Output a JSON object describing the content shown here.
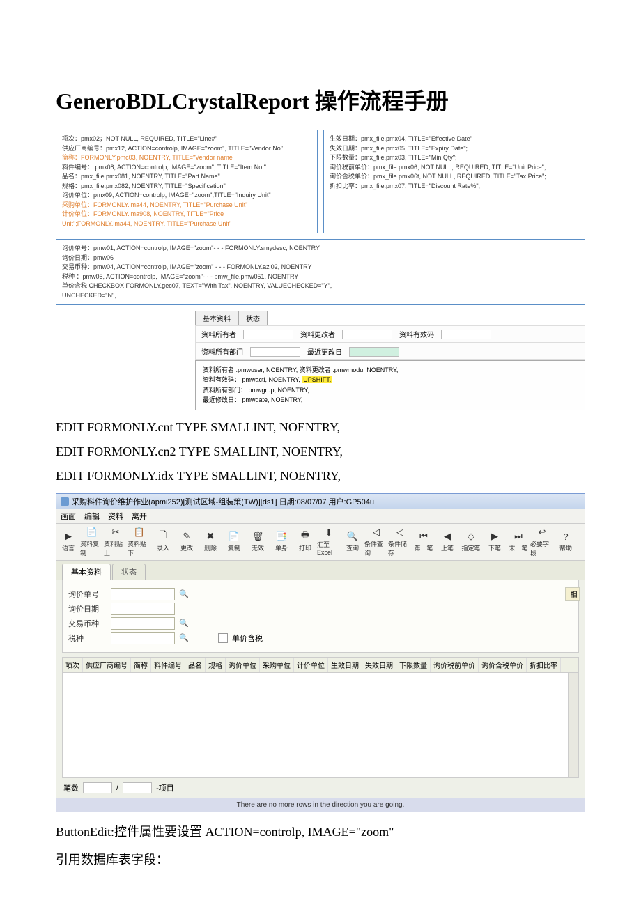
{
  "title": "GeneroBDLCrystalReport 操作流程手册",
  "box_left": [
    "项次：pmx02；NOT NULL, REQUIRED,  TITLE=\"Line#\"",
    "供应厂商编号：pmx12, ACTION=controlp, IMAGE=\"zoom\", TITLE=\"Vendor No\"",
    "简称：FORMONLY.pmc03, NOENTRY, TITLE=\"Vendor name",
    "料件编号： pmx08, ACTION=controlp, IMAGE=\"zoom\", TITLE=\"Item No.\"",
    "品名：pmx_file.pmx081, NOENTRY, TITLE=\"Part Name\"",
    "规格：pmx_file.pmx082, NOENTRY, TITLE=\"Specification\"",
    "询价单位：pmx09, ACTION=controlp, IMAGE=\"zoom\",TITLE=\"Inquiry Unit\"",
    "采购单位：FORMONLY.ima44, NOENTRY, TITLE=\"Purchase Unit\"",
    "计价单位：FORMONLY.ima908, NOENTRY,  TITLE=\"Price",
    "Unit\";FORMONLY.ima44, NOENTRY, TITLE=\"Purchase Unit\""
  ],
  "box_right": [
    "生效日期：pmx_file.pmx04, TITLE=\"Effective Date\"",
    "失效日期：pmx_file.pmx05,  TITLE=\"Expiry Date\";",
    "下限数量：pmx_file.pmx03, TITLE=\"Min.Qty\";",
    "询价税前单价：pmx_file.pmx06, NOT NULL, REQUIRED,  TITLE=\"Unit Price\";",
    "询价含税单价：pmx_file.pmx06t, NOT NULL, REQUIRED, TITLE=\"Tax Price\";",
    "折扣比率：pmx_file.pmx07, TITLE=\"Discount Rate%\";"
  ],
  "box_full": [
    "询价单号：pmw01, ACTION=controlp, IMAGE=\"zoom\"- - - FORMONLY.smydesc, NOENTRY",
    "询价日期：pmw06",
    "交易币种：pmw04, ACTION=controlp, IMAGE=\"zoom\"  - - - FORMONLY.azi02, NOENTRY",
    "税种  ：pmw05, ACTION=controlp, IMAGE=\"zoom\"- - - pmw_file.pmw051, NOENTRY",
    "单价含税   CHECKBOX   FORMONLY.gec07, TEXT=\"With Tax\", NOENTRY, VALUECHECKED=\"Y\",",
    "UNCHECKED=\"N\","
  ],
  "mid_tabs": {
    "t1": "基本资料",
    "t2": "状态"
  },
  "mid_fields": {
    "f1": "资料所有者",
    "f2": "资料更改者",
    "f3": "资料有效码",
    "f4": "资料所有部门",
    "f5": "最近更改日"
  },
  "mid_notes": [
    "资料所有者 :pmwuser, NOENTRY,  资料更改者 :pmwmodu, NOENTRY,",
    "资料有效码： pmwacti, NOENTRY, UPSHIFT,",
    "资料所有部门： pmwgrup, NOENTRY,",
    "最近修改日： pmwdate, NOENTRY,"
  ],
  "edits": [
    "EDIT  FORMONLY.cnt TYPE SMALLINT, NOENTRY,",
    "EDIT FORMONLY.cn2 TYPE SMALLINT, NOENTRY,",
    "EDIT FORMONLY.idx TYPE SMALLINT, NOENTRY,"
  ],
  "app": {
    "title": "采购料件询价维护作业(apmi252)[测试区域-组装策(TW)][ds1]  日期:08/07/07  用户:GP504u",
    "menu": [
      "画面",
      "编辑",
      "资料",
      "离开"
    ],
    "toolbar": [
      {
        "icon": "▶",
        "label": "语言"
      },
      {
        "icon": "📄",
        "label": "资料复制"
      },
      {
        "icon": "✂",
        "label": "资料贴上"
      },
      {
        "icon": "📋",
        "label": "资料贴下"
      },
      {
        "icon": "🗋",
        "label": "录入"
      },
      {
        "icon": "✎",
        "label": "更改"
      },
      {
        "icon": "✖",
        "label": "删除"
      },
      {
        "icon": "📄",
        "label": "复制"
      },
      {
        "icon": "🗑",
        "label": "无效"
      },
      {
        "icon": "📑",
        "label": "单身"
      },
      {
        "icon": "🖶",
        "label": "打印"
      },
      {
        "icon": "⬇",
        "label": "汇至Excel"
      },
      {
        "icon": "🔍",
        "label": "查询"
      },
      {
        "icon": "◁",
        "label": "条件查询"
      },
      {
        "icon": "◁",
        "label": "条件储存"
      },
      {
        "icon": "⏮",
        "label": "第一笔"
      },
      {
        "icon": "◀",
        "label": "上笔"
      },
      {
        "icon": "◇",
        "label": "指定笔"
      },
      {
        "icon": "▶",
        "label": "下笔"
      },
      {
        "icon": "⏭",
        "label": "末一笔"
      },
      {
        "icon": "↩",
        "label": "必要字段"
      },
      {
        "icon": "?",
        "label": "帮助"
      }
    ],
    "tabs": {
      "t1": "基本资料",
      "t2": "状态"
    },
    "side_tab": "相",
    "form": {
      "f1": "询价单号",
      "f2": "询价日期",
      "f3": "交易币种",
      "f4": "税种",
      "chk": "单价含税"
    },
    "grid_cols": [
      "项次",
      "供应厂商编号",
      "简称",
      "料件编号",
      "品名",
      "规格",
      "询价单位",
      "采购单位",
      "计价单位",
      "生效日期",
      "失效日期",
      "下限数量",
      "询价税前单价",
      "询价含税单价",
      "折扣比率"
    ],
    "pager": {
      "label1": "笔数",
      "sep": "/",
      "label2": "-项目"
    },
    "status": "There are no more rows in the direction you are going."
  },
  "footer": [
    "ButtonEdit:控件属性要设置 ACTION=controlp, IMAGE=\"zoom\"",
    "引用数据库表字段："
  ]
}
